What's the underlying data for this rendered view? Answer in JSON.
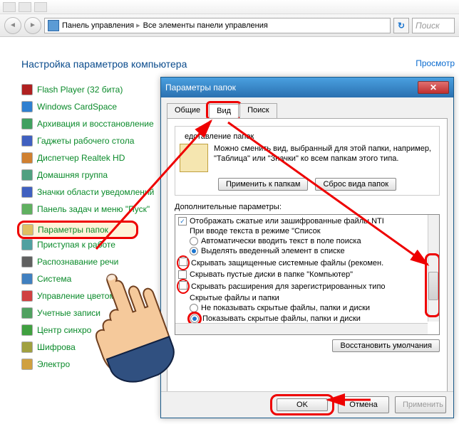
{
  "address": {
    "seg1": "Панель управления",
    "seg2": "Все элементы панели управления",
    "search_placeholder": "Поиск"
  },
  "main": {
    "title": "Настройка параметров компьютера",
    "view_label": "Просмотр"
  },
  "cp_items": [
    {
      "label": "Flash Player (32 бита)",
      "color": "#b02020"
    },
    {
      "label": "Windows CardSpace",
      "color": "#3080d0"
    },
    {
      "label": "Архивация и восстановление",
      "color": "#40a060"
    },
    {
      "label": "Гаджеты рабочего стола",
      "color": "#4060c0"
    },
    {
      "label": "Диспетчер Realtek HD",
      "color": "#d08030"
    },
    {
      "label": "Домашняя группа",
      "color": "#50a080"
    },
    {
      "label": "Значки области уведомлений",
      "color": "#4060c0"
    },
    {
      "label": "Панель задач и меню \"Пуск\"",
      "color": "#60b060"
    },
    {
      "label": "Параметры папок",
      "color": "#e0c060"
    },
    {
      "label": "Приступая к работе",
      "color": "#50a0a0"
    },
    {
      "label": "Распознавание речи",
      "color": "#606060"
    },
    {
      "label": "Система",
      "color": "#4080c0"
    },
    {
      "label": "Управление цветом",
      "color": "#d04040"
    },
    {
      "label": "Учетные записи",
      "color": "#50a060"
    },
    {
      "label": "Центр синхро",
      "color": "#40a040"
    },
    {
      "label": "Шифрова",
      "color": "#a0a040"
    },
    {
      "label": "Электро",
      "color": "#d0a040"
    }
  ],
  "dialog": {
    "title": "Параметры папок",
    "tabs": {
      "general": "Общие",
      "view": "Вид",
      "search": "Поиск"
    },
    "folder_view": {
      "group": "едставление папок",
      "text": "Можно сменить вид, выбранный для этой папки, например, \"Таблица\" или \"Значки\" ко всем папкам этого типа.",
      "apply": "Применить к папкам",
      "reset": "Сброс вида папок"
    },
    "advanced_label": "Дополнительные параметры:",
    "advanced": [
      {
        "type": "checkbox",
        "checked": true,
        "label": "Отображать сжатые или зашифрованные файлы NTI",
        "indent": 0
      },
      {
        "type": "group",
        "label": "При вводе текста в режиме \"Список",
        "indent": 0
      },
      {
        "type": "radio",
        "checked": false,
        "label": "Автоматически вводить текст в поле поиска",
        "indent": 1
      },
      {
        "type": "radio",
        "checked": true,
        "label": "Выделять введенный элемент в списке",
        "indent": 1
      },
      {
        "type": "checkbox",
        "checked": false,
        "label": "Скрывать защищенные системные файлы (рекомен.",
        "indent": 0,
        "highlight": true
      },
      {
        "type": "checkbox",
        "checked": false,
        "label": "Скрывать пустые диски в папке \"Компьютер\"",
        "indent": 0
      },
      {
        "type": "checkbox",
        "checked": false,
        "label": "Скрывать расширения для зарегистрированных типо",
        "indent": 0,
        "highlight": true
      },
      {
        "type": "group",
        "label": "Скрытые файлы и папки",
        "indent": 0
      },
      {
        "type": "radio",
        "checked": false,
        "label": "Не показывать скрытые файлы, папки и диски",
        "indent": 1
      },
      {
        "type": "radio",
        "checked": true,
        "label": "Показывать скрытые файлы, папки и диски",
        "indent": 1,
        "highlight": true
      }
    ],
    "restore_defaults": "Восстановить умолчания",
    "ok": "OK",
    "cancel": "Отмена",
    "apply_btn": "Применить"
  }
}
